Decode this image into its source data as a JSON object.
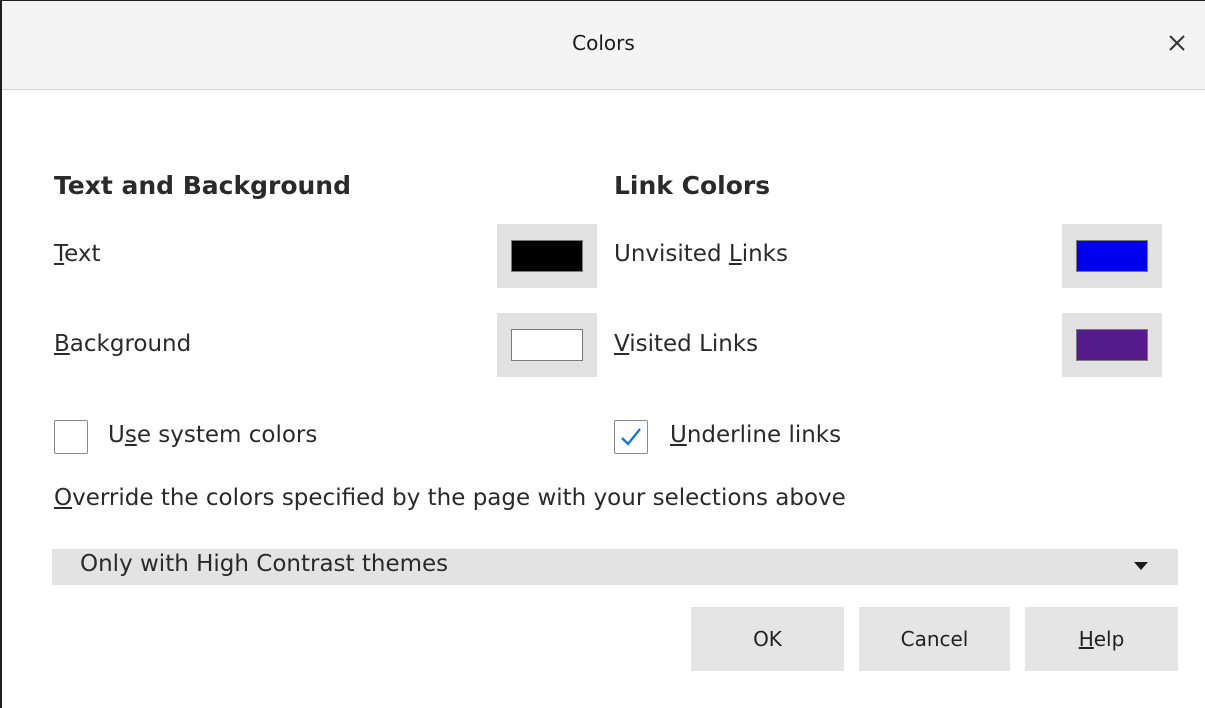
{
  "window": {
    "title": "Colors",
    "close_icon": "close-icon"
  },
  "text_background": {
    "heading": "Text and Background",
    "text_label_mnemonic": "T",
    "text_label_rest": "ext",
    "text_color": "#000000",
    "background_label_mnemonic": "B",
    "background_label_rest": "ackground",
    "background_color": "#ffffff",
    "system_colors_pre": "U",
    "system_colors_mnemonic": "s",
    "system_colors_rest": "e system colors",
    "system_colors_checked": false
  },
  "link_colors": {
    "heading": "Link Colors",
    "unvisited_pre": "Unvisited ",
    "unvisited_mnemonic": "L",
    "unvisited_rest": "inks",
    "unvisited_color": "#0000ee",
    "visited_mnemonic": "V",
    "visited_rest": "isited Links",
    "visited_color": "#551a8b",
    "underline_mnemonic": "U",
    "underline_rest": "nderline links",
    "underline_checked": true
  },
  "override": {
    "label_mnemonic": "O",
    "label_rest": "verride the colors specified by the page with your selections above",
    "selected_value": "Only with High Contrast themes"
  },
  "buttons": {
    "ok": "OK",
    "cancel": "Cancel",
    "help_mnemonic": "H",
    "help_rest": "elp"
  },
  "colors": {
    "accent_check": "#1a73d9",
    "button_bg": "#e5e5e5"
  }
}
